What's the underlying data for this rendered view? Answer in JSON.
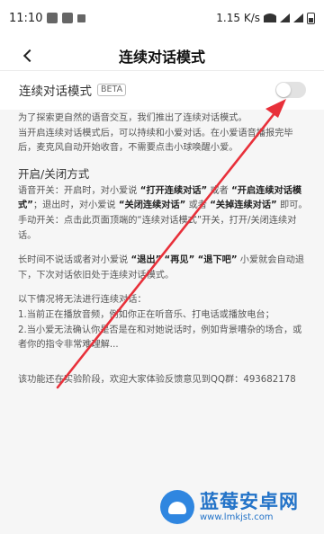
{
  "status_bar": {
    "time": "11:10",
    "speed": "1.15 K/s"
  },
  "header": {
    "title": "连续对话模式"
  },
  "toggle": {
    "label": "连续对话模式",
    "badge": "BETA",
    "enabled": false
  },
  "content": {
    "intro": "为了探索更自然的语音交互，我们推出了连续对话模式。",
    "intro2": "当开启连续对话模式后，可以持续和小爱对话。在小爱语音播报完毕后，麦克风自动开始收音，不需要点击小球唤醒小爱。",
    "section_title": "开启/关闭方式",
    "voice_switch": {
      "prefix": "语音开关：开启时，对小爱说 ",
      "cmd1": "“打开连续对话”",
      "mid1": " 或者 ",
      "cmd2": "“开启连续对话模式”",
      "mid2": "；退出时，对小爱说 ",
      "cmd3": "“关闭连续对话”",
      "mid3": " 或者 ",
      "cmd4": "“关掉连续对话”",
      "suffix": " 即可。"
    },
    "manual_switch": "手动开关：点击此页面顶端的“连续对话模式”开关，打开/关闭连续对话。",
    "exit": {
      "prefix": "长时间不说话或者对小爱说 ",
      "cmd1": "“退出”",
      "cmd2": "“再见”",
      "cmd3": "“退下吧”",
      "suffix": " 小爱就会自动退下，下次对话依旧处于连续对话模式。"
    },
    "limits_title": "以下情况将无法进行连续对话：",
    "limit1": "1.当前正在播放音频，例如你正在听音乐、打电话或播放电台；",
    "limit2": "2.当小爱无法确认你是否是在和对她说话时，例如背景嘈杂的场合，或者你的指令非常难理解...",
    "footer": "该功能还在实验阶段，欢迎大家体验反馈意见到QQ群：493682178"
  },
  "watermark": {
    "title": "蓝莓安卓网",
    "url": "www.lmkjst.com"
  },
  "colors": {
    "arrow": "#e8303a",
    "panel": "#f6f6f6",
    "watermark": "#2373c8"
  }
}
